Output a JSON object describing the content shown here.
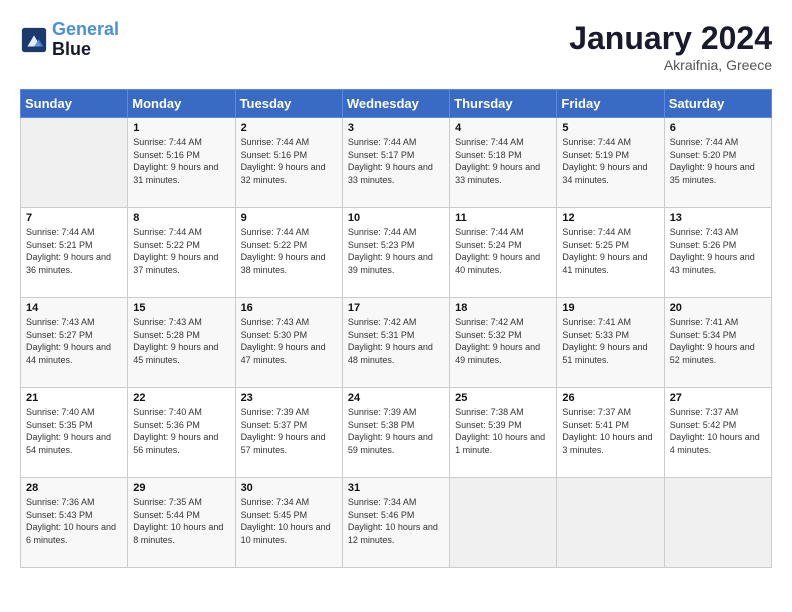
{
  "logo": {
    "line1": "General",
    "line2": "Blue"
  },
  "title": "January 2024",
  "location": "Akraifnia, Greece",
  "days_of_week": [
    "Sunday",
    "Monday",
    "Tuesday",
    "Wednesday",
    "Thursday",
    "Friday",
    "Saturday"
  ],
  "weeks": [
    [
      {
        "day": "",
        "sunrise": "",
        "sunset": "",
        "daylight": ""
      },
      {
        "day": "1",
        "sunrise": "Sunrise: 7:44 AM",
        "sunset": "Sunset: 5:16 PM",
        "daylight": "Daylight: 9 hours and 31 minutes."
      },
      {
        "day": "2",
        "sunrise": "Sunrise: 7:44 AM",
        "sunset": "Sunset: 5:16 PM",
        "daylight": "Daylight: 9 hours and 32 minutes."
      },
      {
        "day": "3",
        "sunrise": "Sunrise: 7:44 AM",
        "sunset": "Sunset: 5:17 PM",
        "daylight": "Daylight: 9 hours and 33 minutes."
      },
      {
        "day": "4",
        "sunrise": "Sunrise: 7:44 AM",
        "sunset": "Sunset: 5:18 PM",
        "daylight": "Daylight: 9 hours and 33 minutes."
      },
      {
        "day": "5",
        "sunrise": "Sunrise: 7:44 AM",
        "sunset": "Sunset: 5:19 PM",
        "daylight": "Daylight: 9 hours and 34 minutes."
      },
      {
        "day": "6",
        "sunrise": "Sunrise: 7:44 AM",
        "sunset": "Sunset: 5:20 PM",
        "daylight": "Daylight: 9 hours and 35 minutes."
      }
    ],
    [
      {
        "day": "7",
        "sunrise": "Sunrise: 7:44 AM",
        "sunset": "Sunset: 5:21 PM",
        "daylight": "Daylight: 9 hours and 36 minutes."
      },
      {
        "day": "8",
        "sunrise": "Sunrise: 7:44 AM",
        "sunset": "Sunset: 5:22 PM",
        "daylight": "Daylight: 9 hours and 37 minutes."
      },
      {
        "day": "9",
        "sunrise": "Sunrise: 7:44 AM",
        "sunset": "Sunset: 5:22 PM",
        "daylight": "Daylight: 9 hours and 38 minutes."
      },
      {
        "day": "10",
        "sunrise": "Sunrise: 7:44 AM",
        "sunset": "Sunset: 5:23 PM",
        "daylight": "Daylight: 9 hours and 39 minutes."
      },
      {
        "day": "11",
        "sunrise": "Sunrise: 7:44 AM",
        "sunset": "Sunset: 5:24 PM",
        "daylight": "Daylight: 9 hours and 40 minutes."
      },
      {
        "day": "12",
        "sunrise": "Sunrise: 7:44 AM",
        "sunset": "Sunset: 5:25 PM",
        "daylight": "Daylight: 9 hours and 41 minutes."
      },
      {
        "day": "13",
        "sunrise": "Sunrise: 7:43 AM",
        "sunset": "Sunset: 5:26 PM",
        "daylight": "Daylight: 9 hours and 43 minutes."
      }
    ],
    [
      {
        "day": "14",
        "sunrise": "Sunrise: 7:43 AM",
        "sunset": "Sunset: 5:27 PM",
        "daylight": "Daylight: 9 hours and 44 minutes."
      },
      {
        "day": "15",
        "sunrise": "Sunrise: 7:43 AM",
        "sunset": "Sunset: 5:28 PM",
        "daylight": "Daylight: 9 hours and 45 minutes."
      },
      {
        "day": "16",
        "sunrise": "Sunrise: 7:43 AM",
        "sunset": "Sunset: 5:30 PM",
        "daylight": "Daylight: 9 hours and 47 minutes."
      },
      {
        "day": "17",
        "sunrise": "Sunrise: 7:42 AM",
        "sunset": "Sunset: 5:31 PM",
        "daylight": "Daylight: 9 hours and 48 minutes."
      },
      {
        "day": "18",
        "sunrise": "Sunrise: 7:42 AM",
        "sunset": "Sunset: 5:32 PM",
        "daylight": "Daylight: 9 hours and 49 minutes."
      },
      {
        "day": "19",
        "sunrise": "Sunrise: 7:41 AM",
        "sunset": "Sunset: 5:33 PM",
        "daylight": "Daylight: 9 hours and 51 minutes."
      },
      {
        "day": "20",
        "sunrise": "Sunrise: 7:41 AM",
        "sunset": "Sunset: 5:34 PM",
        "daylight": "Daylight: 9 hours and 52 minutes."
      }
    ],
    [
      {
        "day": "21",
        "sunrise": "Sunrise: 7:40 AM",
        "sunset": "Sunset: 5:35 PM",
        "daylight": "Daylight: 9 hours and 54 minutes."
      },
      {
        "day": "22",
        "sunrise": "Sunrise: 7:40 AM",
        "sunset": "Sunset: 5:36 PM",
        "daylight": "Daylight: 9 hours and 56 minutes."
      },
      {
        "day": "23",
        "sunrise": "Sunrise: 7:39 AM",
        "sunset": "Sunset: 5:37 PM",
        "daylight": "Daylight: 9 hours and 57 minutes."
      },
      {
        "day": "24",
        "sunrise": "Sunrise: 7:39 AM",
        "sunset": "Sunset: 5:38 PM",
        "daylight": "Daylight: 9 hours and 59 minutes."
      },
      {
        "day": "25",
        "sunrise": "Sunrise: 7:38 AM",
        "sunset": "Sunset: 5:39 PM",
        "daylight": "Daylight: 10 hours and 1 minute."
      },
      {
        "day": "26",
        "sunrise": "Sunrise: 7:37 AM",
        "sunset": "Sunset: 5:41 PM",
        "daylight": "Daylight: 10 hours and 3 minutes."
      },
      {
        "day": "27",
        "sunrise": "Sunrise: 7:37 AM",
        "sunset": "Sunset: 5:42 PM",
        "daylight": "Daylight: 10 hours and 4 minutes."
      }
    ],
    [
      {
        "day": "28",
        "sunrise": "Sunrise: 7:36 AM",
        "sunset": "Sunset: 5:43 PM",
        "daylight": "Daylight: 10 hours and 6 minutes."
      },
      {
        "day": "29",
        "sunrise": "Sunrise: 7:35 AM",
        "sunset": "Sunset: 5:44 PM",
        "daylight": "Daylight: 10 hours and 8 minutes."
      },
      {
        "day": "30",
        "sunrise": "Sunrise: 7:34 AM",
        "sunset": "Sunset: 5:45 PM",
        "daylight": "Daylight: 10 hours and 10 minutes."
      },
      {
        "day": "31",
        "sunrise": "Sunrise: 7:34 AM",
        "sunset": "Sunset: 5:46 PM",
        "daylight": "Daylight: 10 hours and 12 minutes."
      },
      {
        "day": "",
        "sunrise": "",
        "sunset": "",
        "daylight": ""
      },
      {
        "day": "",
        "sunrise": "",
        "sunset": "",
        "daylight": ""
      },
      {
        "day": "",
        "sunrise": "",
        "sunset": "",
        "daylight": ""
      }
    ]
  ]
}
